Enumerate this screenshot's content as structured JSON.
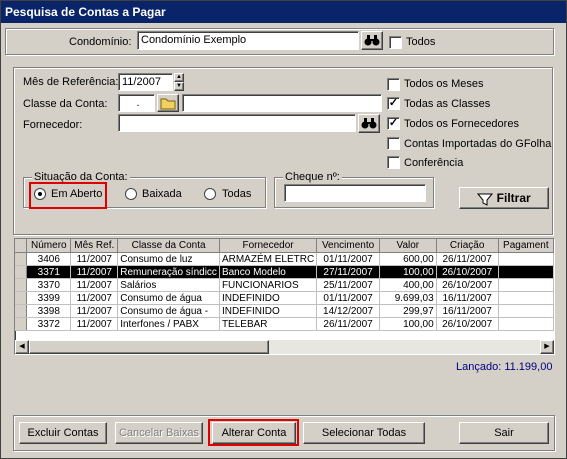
{
  "window": {
    "title": "Pesquisa de Contas a Pagar"
  },
  "top": {
    "condominio_label": "Condomínio:",
    "condominio_value": "Condomínio Exemplo",
    "binoculars_icon": "binoculars-icon",
    "todos_label": "Todos",
    "todos_checked": false
  },
  "filters": {
    "mes_label": "Mês de Referência:",
    "mes_value": "11/2007",
    "classe_label": "Classe da Conta:",
    "classe_code": ".",
    "classe_desc": "",
    "fornecedor_label": "Fornecedor:",
    "fornecedor_value": "",
    "checks": [
      {
        "label": "Todos os Meses",
        "checked": false
      },
      {
        "label": "Todas as Classes",
        "checked": true
      },
      {
        "label": "Todos os Fornecedores",
        "checked": true
      },
      {
        "label": "Contas Importadas do GFolha",
        "checked": false
      },
      {
        "label": "Conferência",
        "checked": false
      }
    ],
    "situacao_label": "Situação da Conta:",
    "situacao_options": [
      "Em Aberto",
      "Baixada",
      "Todas"
    ],
    "situacao_selected": "Em Aberto",
    "cheque_label": "Cheque nº:",
    "cheque_value": "",
    "filtrar_label": "Filtrar"
  },
  "grid": {
    "columns": [
      "Número",
      "Mês Ref.",
      "Classe da Conta",
      "Fornecedor",
      "Vencimento",
      "Valor",
      "Criação",
      "Pagament"
    ],
    "rows": [
      [
        "3406",
        "11/2007",
        "Consumo de luz",
        "ARMAZÉM ELETRC",
        "01/11/2007",
        "600,00",
        "26/11/2007",
        ""
      ],
      [
        "3371",
        "11/2007",
        "Remuneração síndicc",
        "Banco Modelo",
        "27/11/2007",
        "100,00",
        "26/10/2007",
        ""
      ],
      [
        "3370",
        "11/2007",
        "Salários",
        "FUNCIONARIOS",
        "25/11/2007",
        "400,00",
        "26/10/2007",
        ""
      ],
      [
        "3399",
        "11/2007",
        "Consumo de água",
        "INDEFINIDO",
        "01/11/2007",
        "9.699,03",
        "16/11/2007",
        ""
      ],
      [
        "3398",
        "11/2007",
        "Consumo de água -",
        "INDEFINIDO",
        "14/12/2007",
        "299,97",
        "16/11/2007",
        ""
      ],
      [
        "3372",
        "11/2007",
        "Interfones / PABX",
        "TELEBAR",
        "26/11/2007",
        "100,00",
        "26/10/2007",
        ""
      ]
    ],
    "selected_row": 1
  },
  "total_label": "Lançado: 11.199,00",
  "buttons": {
    "excluir": "Excluir Contas",
    "cancelar": "Cancelar Baixas",
    "alterar": "Alterar Conta",
    "selecionar": "Selecionar Todas",
    "sair": "Sair"
  }
}
